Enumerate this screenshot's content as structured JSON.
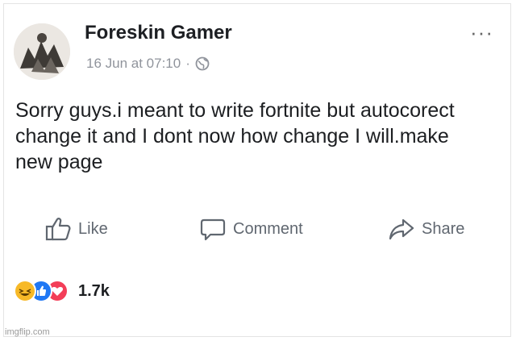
{
  "post": {
    "author": "Foreskin Gamer",
    "timestamp": "16 Jun at 07:10",
    "separator": "·",
    "privacy_icon": "globe-icon",
    "more_icon": "···",
    "text": "Sorry guys.i meant to write fortnite but autocorect change it and I dont now how change I will.make new page"
  },
  "actions": {
    "like": "Like",
    "comment": "Comment",
    "share": "Share"
  },
  "reactions": {
    "icons": [
      "haha-icon",
      "like-icon",
      "love-icon"
    ],
    "count": "1.7k"
  },
  "watermark": "imgflip.com",
  "colors": {
    "action_gray": "#606770",
    "meta_gray": "#90949c",
    "like_blue": "#2078f4",
    "love_red": "#f33e58",
    "haha_yellow": "#f7b928"
  }
}
